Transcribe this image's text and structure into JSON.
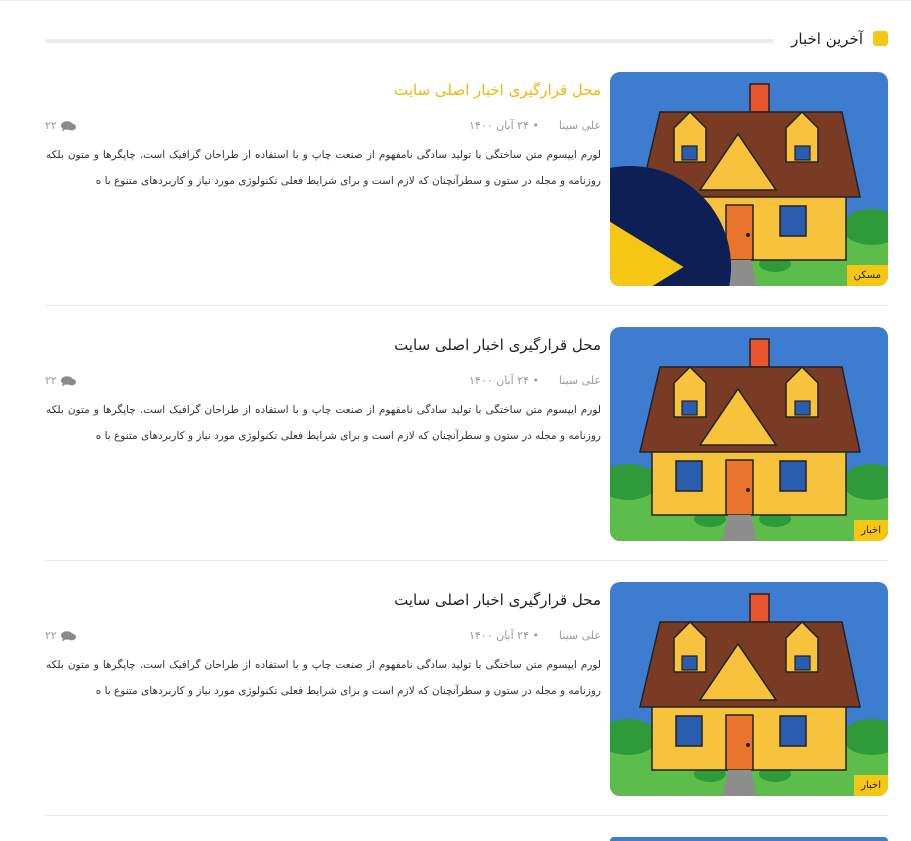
{
  "section": {
    "title": "آخرین اخبار"
  },
  "posts": [
    {
      "title": "محل قرارگیری اخبار اصلی سایت",
      "author": "علی سینا",
      "date": "۲۴ آبان ۱۴۰۰",
      "comments": "۲۲",
      "excerpt": "لورم ایپسوم متن ساختگی با تولید سادگی نامفهوم از صنعت چاپ و با استفاده از طراحان گرافیک است. چاپگرها و متون بلکه روزنامه و مجله در ستون و سطرآنچنان که لازم است و برای شرایط فعلی تکنولوژی مورد نیاز و کاربردهای متنوع با ه",
      "category": "مسکن",
      "highlighted": true,
      "has_video": true
    },
    {
      "title": "محل قرارگیری اخبار اصلی سایت",
      "author": "علی سینا",
      "date": "۲۴ آبان ۱۴۰۰",
      "comments": "۲۲",
      "excerpt": "لورم ایپسوم متن ساختگی با تولید سادگی نامفهوم از صنعت چاپ و با استفاده از طراحان گرافیک است. چاپگرها و متون بلکه روزنامه و مجله در ستون و سطرآنچنان که لازم است و برای شرایط فعلی تکنولوژی مورد نیاز و کاربردهای متنوع با ه",
      "category": "اخبار",
      "highlighted": false,
      "has_video": false
    },
    {
      "title": "محل قرارگیری اخبار اصلی سایت",
      "author": "علی سینا",
      "date": "۲۴ آبان ۱۴۰۰",
      "comments": "۲۲",
      "excerpt": "لورم ایپسوم متن ساختگی با تولید سادگی نامفهوم از صنعت چاپ و با استفاده از طراحان گرافیک است. چاپگرها و متون بلکه روزنامه و مجله در ستون و سطرآنچنان که لازم است و برای شرایط فعلی تکنولوژی مورد نیاز و کاربردهای متنوع با ه",
      "category": "اخبار",
      "highlighted": false,
      "has_video": false
    }
  ],
  "icons": {
    "comment": "comments-icon",
    "play": "play-icon",
    "section_marker": "square-icon"
  },
  "colors": {
    "accent": "#f6c615",
    "title_highlight": "#f2b705",
    "meta": "#9a9a9a",
    "text": "#333333"
  }
}
